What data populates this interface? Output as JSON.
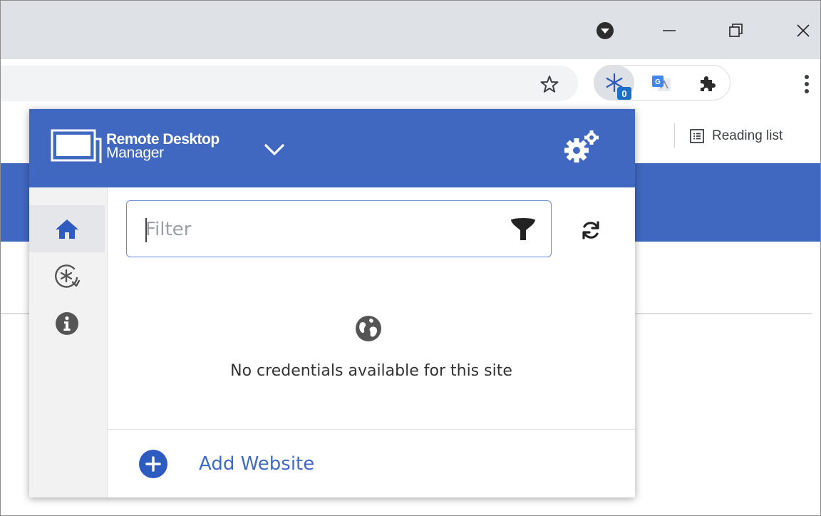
{
  "browser": {
    "window_controls": {
      "profile_icon": "dropdown-circle-icon",
      "minimize_icon": "minimize-icon",
      "restore_icon": "restore-icon",
      "close_icon": "close-icon"
    },
    "toolbar": {
      "star_icon": "bookmark-star-icon",
      "extensions": [
        {
          "name": "remote-desktop-manager-extension",
          "badge": "0"
        },
        {
          "name": "google-translate-extension"
        },
        {
          "name": "extensions-puzzle-icon"
        }
      ],
      "menu_icon": "kebab-menu-icon"
    },
    "bookmarks_bar": {
      "reading_list_label": "Reading list"
    }
  },
  "popup": {
    "brand": {
      "line1": "Remote Desktop",
      "line2": "Manager"
    },
    "colors": {
      "header_bg": "#4068c1",
      "accent": "#2e5bbf",
      "link": "#3f6bc6"
    },
    "sidebar": {
      "items": [
        {
          "name": "home",
          "icon": "home-icon",
          "active": true
        },
        {
          "name": "password-generator",
          "icon": "asterisk-circle-icon",
          "active": false
        },
        {
          "name": "about",
          "icon": "info-icon",
          "active": false
        }
      ]
    },
    "filter": {
      "placeholder": "Filter",
      "value": ""
    },
    "empty_state": {
      "icon": "globe-icon",
      "message": "No credentials available for this site"
    },
    "footer": {
      "add_label": "Add Website"
    }
  }
}
